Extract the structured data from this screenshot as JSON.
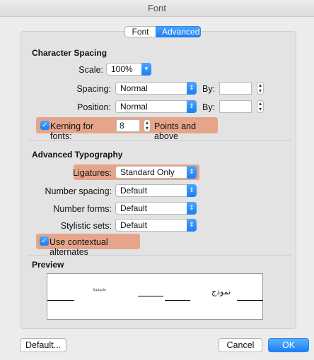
{
  "window": {
    "title": "Font"
  },
  "tabs": [
    {
      "label": "Font"
    },
    {
      "label": "Advanced"
    }
  ],
  "character_spacing": {
    "title": "Character Spacing",
    "scale_label": "Scale:",
    "scale_value": "100%",
    "spacing_label": "Spacing:",
    "spacing_value": "Normal",
    "spacing_by_label": "By:",
    "spacing_by_value": "",
    "position_label": "Position:",
    "position_value": "Normal",
    "position_by_label": "By:",
    "position_by_value": "",
    "kerning_label": "Kerning for fonts:",
    "kerning_value": "8",
    "kerning_suffix": "Points and above",
    "kerning_checked": true
  },
  "advanced_typography": {
    "title": "Advanced Typography",
    "ligatures_label": "Ligatures:",
    "ligatures_value": "Standard Only",
    "number_spacing_label": "Number spacing:",
    "number_spacing_value": "Default",
    "number_forms_label": "Number forms:",
    "number_forms_value": "Default",
    "stylistic_sets_label": "Stylistic sets:",
    "stylistic_sets_value": "Default",
    "contextual_label": "Use contextual alternates",
    "contextual_checked": true
  },
  "preview": {
    "title": "Preview",
    "sample_text": "Sample",
    "arabic_text": "نموذج"
  },
  "footer": {
    "default_label": "Default...",
    "cancel_label": "Cancel",
    "ok_label": "OK"
  },
  "colors": {
    "accent": "#1b7ff4",
    "highlight": "#e6a58b"
  }
}
